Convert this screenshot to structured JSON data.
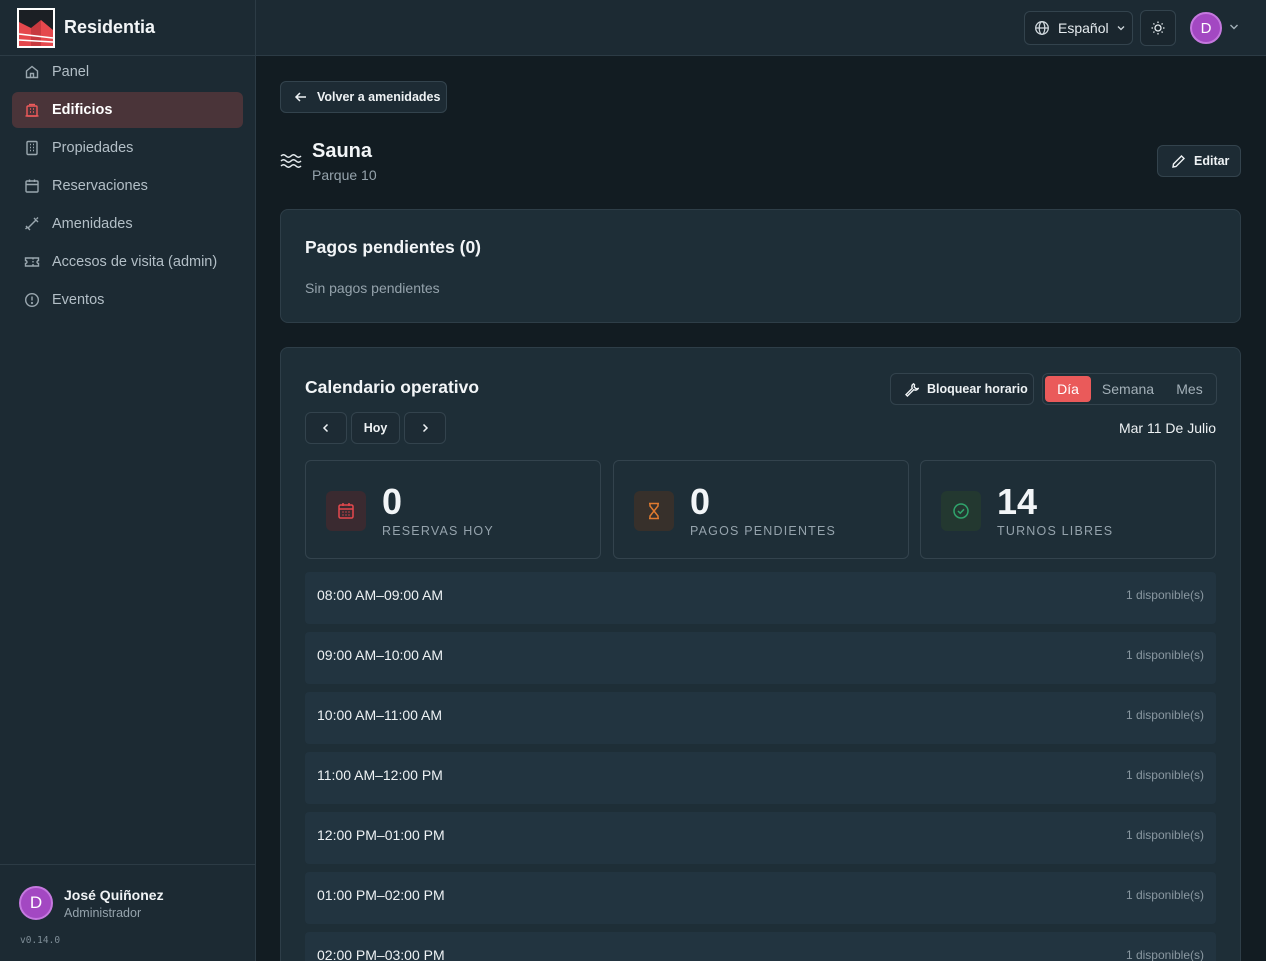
{
  "app": {
    "name": "Residentia",
    "version": "v0.14.0"
  },
  "sidebar": {
    "items": [
      {
        "label": "Panel",
        "icon": "home-icon"
      },
      {
        "label": "Edificios",
        "icon": "building-icon",
        "active": true
      },
      {
        "label": "Propiedades",
        "icon": "property-icon"
      },
      {
        "label": "Reservaciones",
        "icon": "calendar-icon"
      },
      {
        "label": "Amenidades",
        "icon": "dumbbell-icon"
      },
      {
        "label": "Accesos de visita (admin)",
        "icon": "ticket-icon"
      },
      {
        "label": "Eventos",
        "icon": "alert-circle-icon"
      }
    ]
  },
  "user": {
    "initial": "D",
    "name": "José Quiñonez",
    "role": "Administrador"
  },
  "topbar": {
    "language": "Español"
  },
  "page": {
    "back_label": "Volver a amenidades",
    "title": "Sauna",
    "subtitle": "Parque 10",
    "edit_label": "Editar"
  },
  "pending": {
    "title": "Pagos pendientes (0)",
    "empty": "Sin pagos pendientes"
  },
  "calendar": {
    "title": "Calendario operativo",
    "block_label": "Bloquear horario",
    "views": [
      "Día",
      "Semana",
      "Mes"
    ],
    "active_view": "Día",
    "today_label": "Hoy",
    "date": "Mar 11 De Julio",
    "stats": [
      {
        "value": "0",
        "label": "RESERVAS HOY",
        "color": "#e5484d"
      },
      {
        "value": "0",
        "label": "PAGOS PENDIENTES",
        "color": "#e07a2f"
      },
      {
        "value": "14",
        "label": "TURNOS LIBRES",
        "color": "#30a46c"
      }
    ],
    "slots": [
      {
        "time": "08:00 AM–09:00 AM",
        "availability": "1 disponible(s)"
      },
      {
        "time": "09:00 AM–10:00 AM",
        "availability": "1 disponible(s)"
      },
      {
        "time": "10:00 AM–11:00 AM",
        "availability": "1 disponible(s)"
      },
      {
        "time": "11:00 AM–12:00 PM",
        "availability": "1 disponible(s)"
      },
      {
        "time": "12:00 PM–01:00 PM",
        "availability": "1 disponible(s)"
      },
      {
        "time": "01:00 PM–02:00 PM",
        "availability": "1 disponible(s)"
      },
      {
        "time": "02:00 PM–03:00 PM",
        "availability": "1 disponible(s)"
      }
    ]
  }
}
